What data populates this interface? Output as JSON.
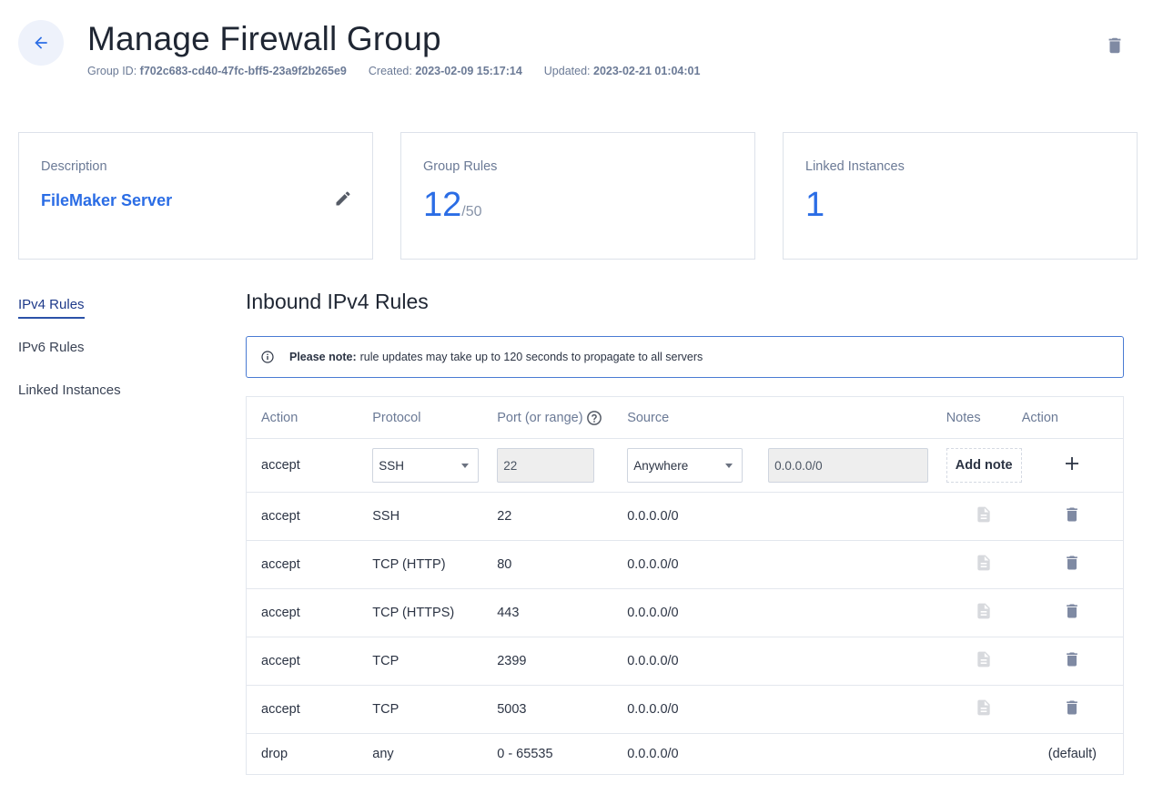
{
  "header": {
    "title": "Manage Firewall Group",
    "group_id_label": "Group ID:",
    "group_id": "f702c683-cd40-47fc-bff5-23a9f2b265e9",
    "created_label": "Created:",
    "created": "2023-02-09 15:17:14",
    "updated_label": "Updated:",
    "updated": "2023-02-21 01:04:01"
  },
  "cards": {
    "description": {
      "label": "Description",
      "value": "FileMaker Server"
    },
    "group_rules": {
      "label": "Group Rules",
      "value": "12",
      "max": "/50"
    },
    "linked": {
      "label": "Linked Instances",
      "value": "1"
    }
  },
  "sidebar": {
    "items": [
      {
        "label": "IPv4 Rules",
        "active": true
      },
      {
        "label": "IPv6 Rules"
      },
      {
        "label": "Linked Instances"
      }
    ]
  },
  "section": {
    "title": "Inbound IPv4 Rules",
    "note_bold": "Please note:",
    "note_text": "rule updates may take up to 120 seconds to propagate to all servers"
  },
  "table": {
    "headers": {
      "action": "Action",
      "protocol": "Protocol",
      "port": "Port (or range)",
      "source": "Source",
      "notes": "Notes",
      "action2": "Action"
    },
    "new_rule": {
      "action": "accept",
      "protocol": "SSH",
      "port": "22",
      "source": "Anywhere",
      "cidr": "0.0.0.0/0",
      "add_note": "Add note"
    },
    "rows": [
      {
        "action": "accept",
        "protocol": "SSH",
        "port": "22",
        "source": "0.0.0.0/0"
      },
      {
        "action": "accept",
        "protocol": "TCP (HTTP)",
        "port": "80",
        "source": "0.0.0.0/0"
      },
      {
        "action": "accept",
        "protocol": "TCP (HTTPS)",
        "port": "443",
        "source": "0.0.0.0/0"
      },
      {
        "action": "accept",
        "protocol": "TCP",
        "port": "2399",
        "source": "0.0.0.0/0"
      },
      {
        "action": "accept",
        "protocol": "TCP",
        "port": "5003",
        "source": "0.0.0.0/0"
      }
    ],
    "default_row": {
      "action": "drop",
      "protocol": "any",
      "port": "0 - 65535",
      "source": "0.0.0.0/0",
      "tag": "(default)"
    }
  },
  "colors": {
    "accent": "#2b6de5",
    "muted": "#6b7a96",
    "icon": "#7f8aa3"
  }
}
